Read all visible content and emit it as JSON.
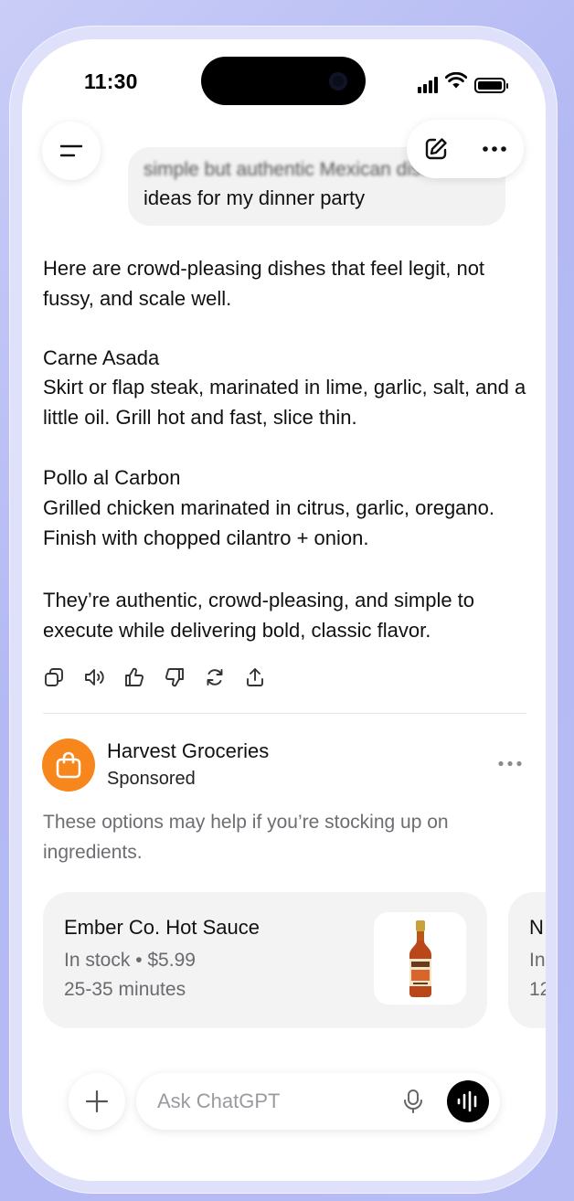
{
  "status_bar": {
    "time": "11:30"
  },
  "conversation": {
    "user_message": {
      "line1": "simple but authentic Mexican dish",
      "line2": "ideas for my dinner party"
    },
    "assistant": {
      "intro": "Here are crowd-pleasing dishes that feel legit, not fussy, and scale well.",
      "dish1_title": "Carne Asada",
      "dish1_body": "Skirt or flap steak, marinated in lime, garlic, salt, and a little oil. Grill hot and fast, slice thin.",
      "dish2_title": "Pollo al Carbon",
      "dish2_body": "Grilled chicken marinated in citrus, garlic, oregano. Finish with chopped cilantro + onion.",
      "closing": "They’re authentic, crowd-pleasing, and simple to execute while delivering bold, classic flavor."
    }
  },
  "ad": {
    "advertiser": "Harvest Groceries",
    "label": "Sponsored",
    "description": "These options may help if you’re stocking up on ingredients.",
    "products": [
      {
        "name": "Ember Co. Hot Sauce",
        "stock_price": "In stock • $5.99",
        "delivery": "25-35 minutes"
      },
      {
        "name": "N",
        "stock_price": "In",
        "delivery": "12"
      }
    ]
  },
  "composer": {
    "placeholder": "Ask ChatGPT"
  },
  "colors": {
    "accent_orange": "#f7861c",
    "background": "#b7bcf5"
  }
}
